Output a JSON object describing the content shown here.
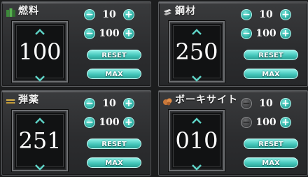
{
  "colors": {
    "accent": "#45c7bb",
    "panel": "#2f3032",
    "text": "#ffffff"
  },
  "resources": [
    {
      "name": "燃料",
      "icon": "fuel-icon",
      "value": "100",
      "steps": [
        "10",
        "100"
      ],
      "reset_label": "RESET",
      "max_label": "MAX",
      "steppers_enabled": true
    },
    {
      "name": "鋼材",
      "icon": "steel-icon",
      "value": "250",
      "steps": [
        "10",
        "100"
      ],
      "reset_label": "RESET",
      "max_label": "MAX",
      "steppers_enabled": true
    },
    {
      "name": "弾薬",
      "icon": "ammo-icon",
      "value": "251",
      "steps": [
        "10",
        "100"
      ],
      "reset_label": "RESET",
      "max_label": "MAX",
      "steppers_enabled": true
    },
    {
      "name": "ボーキサイト",
      "icon": "bauxite-icon",
      "value": "010",
      "steps": [
        "10",
        "100"
      ],
      "reset_label": "RESET",
      "max_label": "MAX",
      "steppers_enabled": false
    }
  ]
}
